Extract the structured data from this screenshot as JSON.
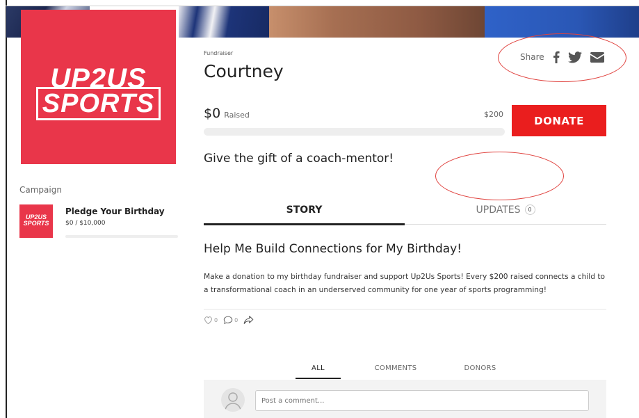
{
  "brand": {
    "logo_line1": "UP2US",
    "logo_line2": "SPORTS",
    "accent": "#e9364a",
    "donate_color": "#ea1e1e"
  },
  "sidebar": {
    "campaign_label": "Campaign",
    "campaign": {
      "thumb_line1": "UP2US",
      "thumb_line2": "SPORTS",
      "title": "Pledge Your Birthday",
      "amount": "$0 / $10,000",
      "progress_fraction": 0
    }
  },
  "fundraiser": {
    "kicker": "Fundraiser",
    "name": "Courtney",
    "share_label": "Share",
    "share_icons": [
      "facebook-icon",
      "twitter-icon",
      "email-icon"
    ],
    "raised_amount": "$0",
    "raised_label": "Raised",
    "goal": "$200",
    "progress_fraction": 0,
    "donate_label": "DONATE",
    "tagline": "Give the gift of a coach-mentor!"
  },
  "tabs": {
    "story": "STORY",
    "updates": "UPDATES",
    "updates_count": "0"
  },
  "story": {
    "title": "Help Me Build Connections for My Birthday!",
    "body": "Make a donation to my birthday fundraiser and support Up2Us Sports! Every $200 raised connects a child to a transformational coach in an underserved community for one year of sports programming!",
    "likes": "0",
    "comments": "0"
  },
  "feed": {
    "tabs": [
      "ALL",
      "COMMENTS",
      "DONORS"
    ],
    "comment_placeholder": "Post a comment..."
  }
}
